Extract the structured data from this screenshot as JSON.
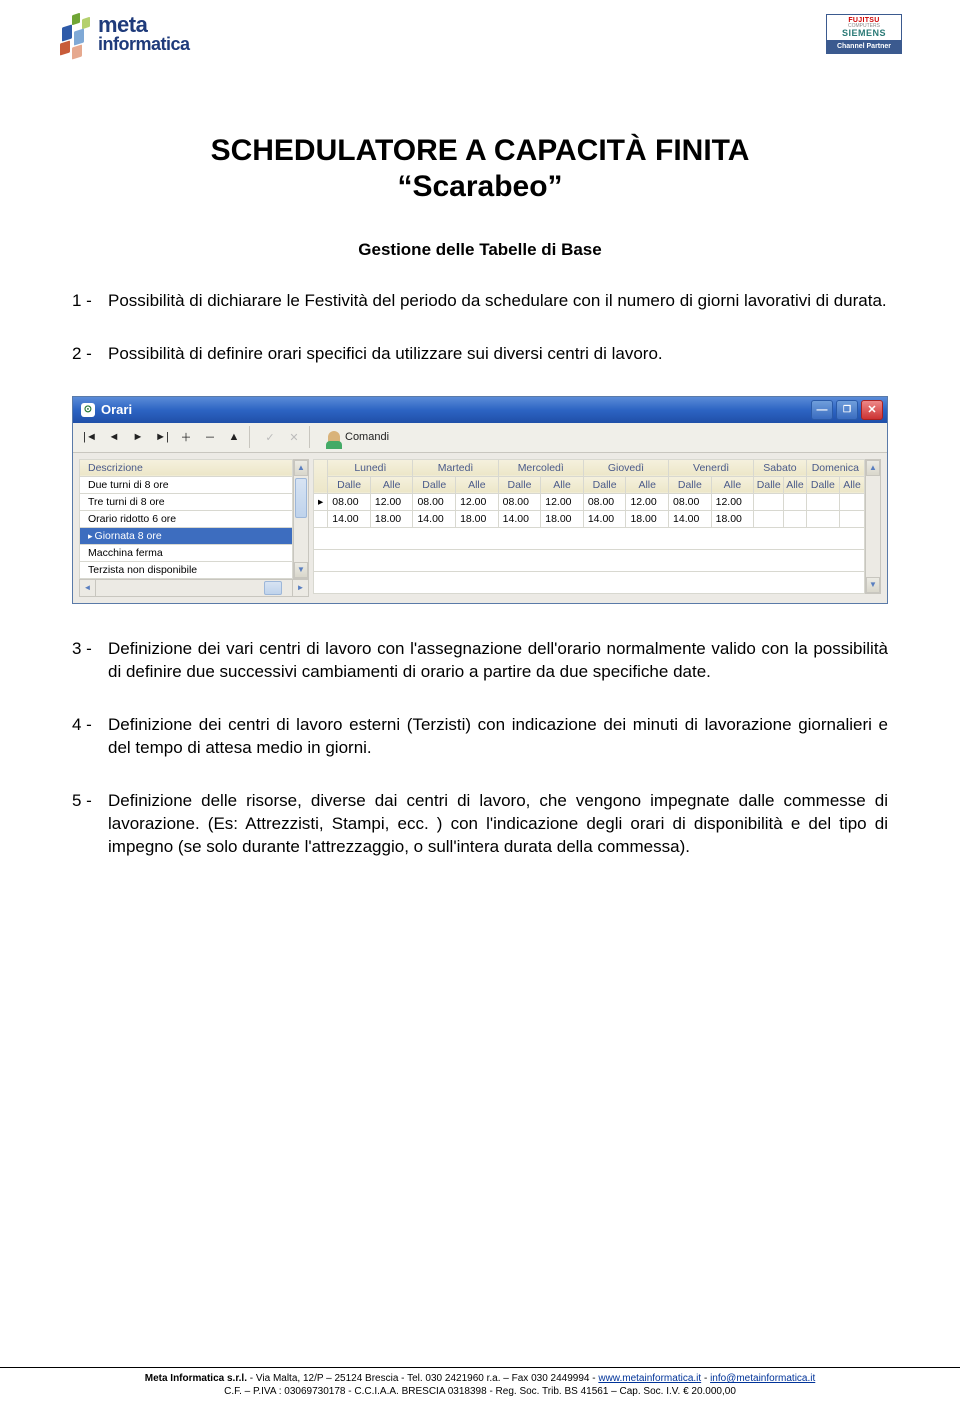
{
  "logo": {
    "line1": "meta",
    "line2": "informatica"
  },
  "partner_badge": {
    "brand1": "FUJITSU",
    "subbrand": "COMPUTERS",
    "brand2": "SIEMENS",
    "label": "Channel Partner"
  },
  "title_line1": "SCHEDULATORE A CAPACITÀ FINITA",
  "title_line2": "“Scarabeo”",
  "subtitle": "Gestione delle Tabelle di Base",
  "paragraphs": {
    "p1": {
      "num": "1 -",
      "text": "Possibilità di dichiarare le Festività del periodo da schedulare con il numero di giorni lavorativi di durata."
    },
    "p2": {
      "num": "2 -",
      "text": "Possibilità di definire orari specifici da utilizzare sui diversi centri di lavoro."
    },
    "p3": {
      "num": "3 -",
      "text": "Definizione dei vari centri di lavoro con l'assegnazione dell'orario normalmente valido con la possibilità di definire due successivi cambiamenti di orario a partire da due specifiche date."
    },
    "p4": {
      "num": "4 -",
      "text": "Definizione dei centri di lavoro esterni (Terzisti) con indicazione dei minuti di lavorazione giornalieri e del tempo di attesa medio in giorni."
    },
    "p5": {
      "num": "5 -",
      "text": "Definizione delle risorse, diverse dai centri di lavoro, che vengono impegnate dalle commesse di lavorazione. (Es: Attrezzisti, Stampi, ecc. ) con l'indicazione degli orari di disponibilità e del tipo di impegno (se solo durante l'attrezzaggio, o sull'intera durata della commessa)."
    }
  },
  "window": {
    "title": "Orari",
    "commands_label": "Comandi",
    "left_header": "Descrizione",
    "left_rows": [
      "Due turni di 8 ore",
      "Tre turni di 8 ore",
      "Orario ridotto 6 ore",
      "Giornata 8 ore",
      "Macchina ferma",
      "Terzista non disponibile"
    ],
    "selected_index": 3,
    "days": [
      "Lunedì",
      "Martedì",
      "Mercoledì",
      "Giovedì",
      "Venerdì",
      "Sabato",
      "Domenica"
    ],
    "subcols": [
      "Dalle",
      "Alle"
    ],
    "data_rows": [
      [
        "08.00",
        "12.00",
        "08.00",
        "12.00",
        "08.00",
        "12.00",
        "08.00",
        "12.00",
        "08.00",
        "12.00",
        "",
        "",
        "",
        ""
      ],
      [
        "14.00",
        "18.00",
        "14.00",
        "18.00",
        "14.00",
        "18.00",
        "14.00",
        "18.00",
        "14.00",
        "18.00",
        "",
        "",
        "",
        ""
      ]
    ]
  },
  "footer": {
    "company": "Meta Informatica s.r.l.",
    "addr": " - Via Malta, 12/P – 25124 Brescia - Tel. 030 2421960 r.a. – Fax 030 2449994 - ",
    "url": "www.metainformatica.it",
    "sep": " - ",
    "email": "info@metainformatica.it",
    "line2": "C.F. – P.IVA : 03069730178 - C.C.I.A.A. BRESCIA 0318398 - Reg. Soc. Trib. BS 41561 – Cap. Soc. I.V. € 20.000,00"
  }
}
